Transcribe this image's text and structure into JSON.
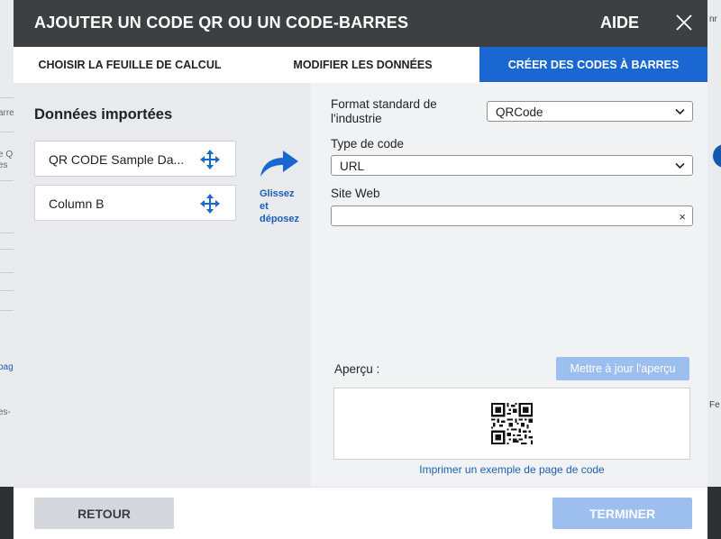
{
  "background": {
    "left_fragments": [
      "arre",
      "e QR",
      "es",
      "pag",
      "es-"
    ],
    "right_fragments": [
      "nr",
      "Fe"
    ]
  },
  "dialog": {
    "title": "AJOUTER UN CODE QR OU UN CODE-BARRES",
    "help_label": "AIDE",
    "close_icon": "close-icon"
  },
  "tabs": [
    {
      "label": "CHOISIR LA FEUILLE DE CALCUL",
      "active": false
    },
    {
      "label": "MODIFIER LES DONNÉES",
      "active": false
    },
    {
      "label": "CRÉER DES CODES À BARRES",
      "active": true
    }
  ],
  "imported": {
    "title": "Données importées",
    "fields": [
      {
        "label": "QR CODE Sample Da..."
      },
      {
        "label": "Column B"
      }
    ],
    "drag_hint": [
      "Glissez",
      "et",
      "déposez"
    ]
  },
  "form": {
    "format_label_line1": "Format standard de",
    "format_label_line2": "l'industrie",
    "format_value": "QRCode",
    "code_type_label": "Type de code",
    "code_type_value": "URL",
    "website_label": "Site Web",
    "website_value": "",
    "clear_icon": "×"
  },
  "preview": {
    "label": "Aperçu :",
    "update_button": "Mettre à jour l'aperçu",
    "print_link": "Imprimer un exemple de page de code"
  },
  "footer": {
    "back_button": "RETOUR",
    "finish_button": "TERMINER"
  },
  "colors": {
    "header_bg": "#3d3f43",
    "accent": "#1a67d2",
    "disabled_btn": "#9dbff0",
    "left_pane": "#e8eaed",
    "right_pane": "#f1f2f4"
  }
}
